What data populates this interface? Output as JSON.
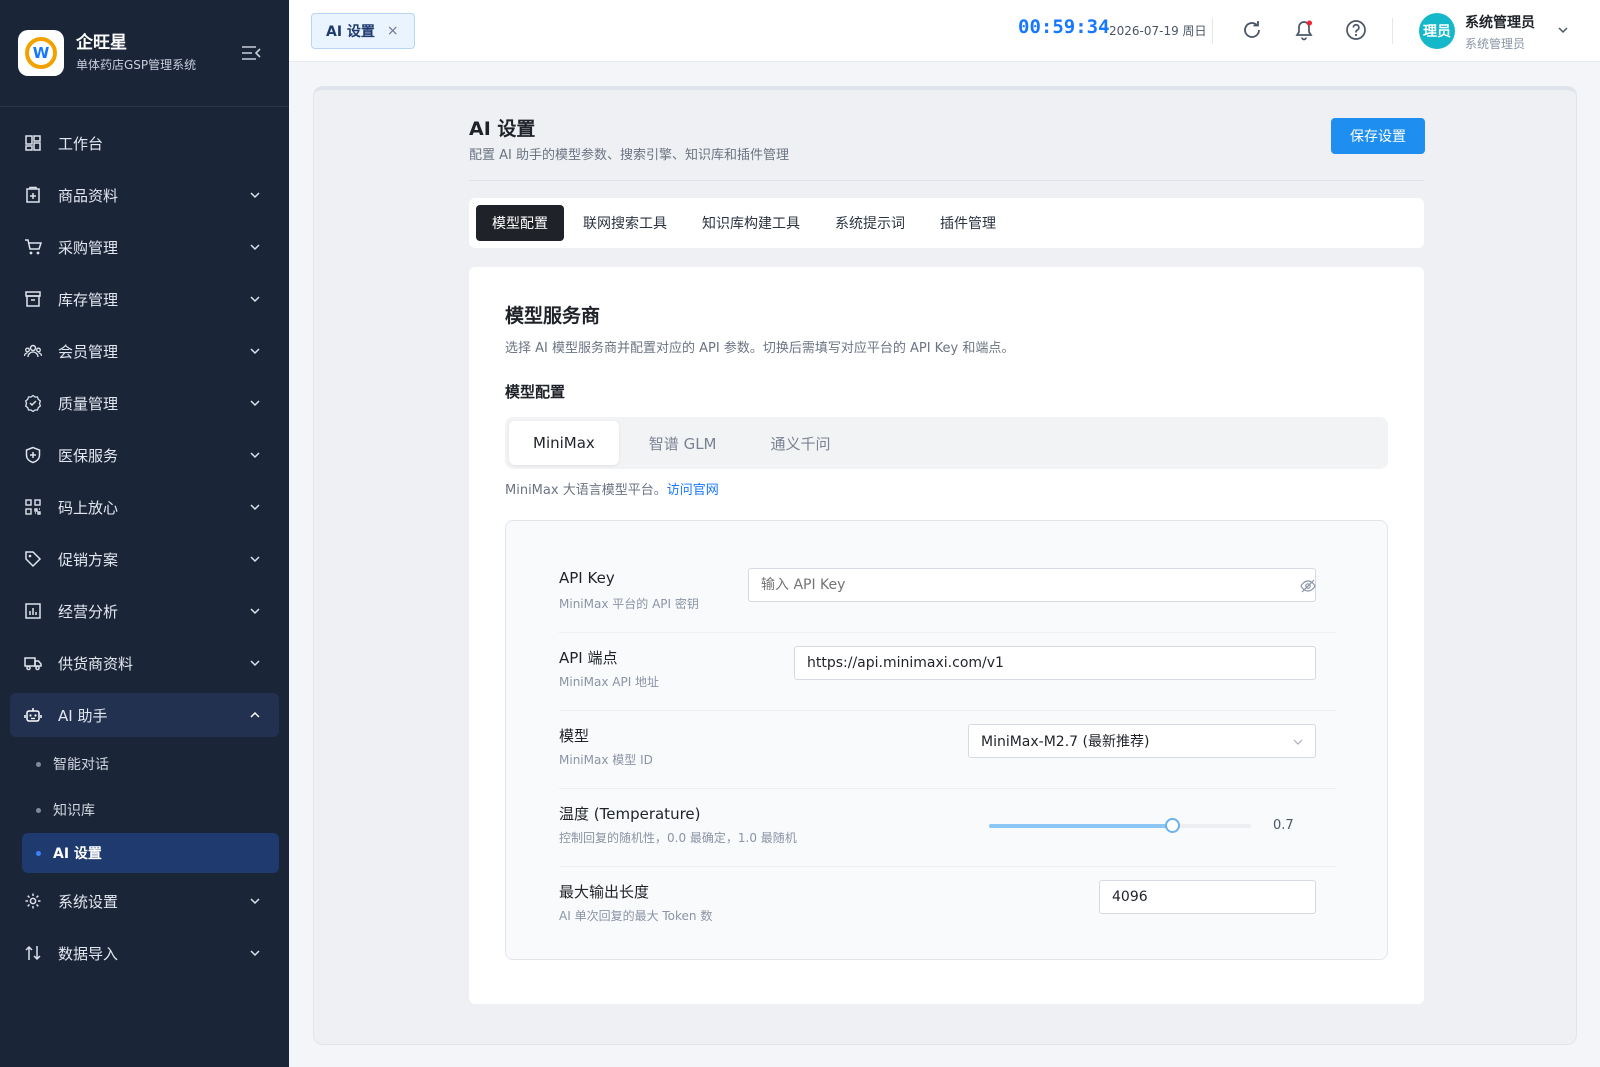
{
  "brand": {
    "title": "企旺星",
    "subtitle": "单体药店GSP管理系统",
    "logo_letter": "W"
  },
  "sidebar": {
    "items": [
      {
        "label": "工作台",
        "icon": "dashboard-icon"
      },
      {
        "label": "商品资料",
        "icon": "product-icon"
      },
      {
        "label": "采购管理",
        "icon": "cart-icon"
      },
      {
        "label": "库存管理",
        "icon": "archive-icon"
      },
      {
        "label": "会员管理",
        "icon": "members-icon"
      },
      {
        "label": "质量管理",
        "icon": "badge-check-icon"
      },
      {
        "label": "医保服务",
        "icon": "shield-plus-icon"
      },
      {
        "label": "码上放心",
        "icon": "qrcode-icon"
      },
      {
        "label": "促销方案",
        "icon": "tag-icon"
      },
      {
        "label": "经营分析",
        "icon": "bar-chart-icon"
      },
      {
        "label": "供货商资料",
        "icon": "truck-icon"
      },
      {
        "label": "AI 助手",
        "icon": "robot-icon"
      },
      {
        "label": "系统设置",
        "icon": "gear-icon"
      },
      {
        "label": "数据导入",
        "icon": "import-icon"
      }
    ],
    "ai_sub": [
      {
        "label": "智能对话"
      },
      {
        "label": "知识库"
      },
      {
        "label": "AI 设置"
      }
    ]
  },
  "header": {
    "tab_label": "AI 设置",
    "tab_close": "×",
    "clock": "00:59:34",
    "date": "2026-07-19 周日",
    "avatar_text": "理员",
    "user_name": "系统管理员",
    "user_role": "系统管理员",
    "notification_dot_color": "#f5222d"
  },
  "page": {
    "title": "AI 设置",
    "description": "配置 AI 助手的模型参数、搜索引擎、知识库和插件管理",
    "save_label": "保存设置",
    "tabs": [
      "模型配置",
      "联网搜索工具",
      "知识库构建工具",
      "系统提示词",
      "插件管理"
    ]
  },
  "card": {
    "title": "模型服务商",
    "description": "选择 AI 模型服务商并配置对应的 API 参数。切换后需填写对应平台的 API Key 和端点。",
    "section_title": "模型配置",
    "providers": [
      "MiniMax",
      "智谱 GLM",
      "通义千问"
    ],
    "provider_note": "MiniMax 大语言模型平台。",
    "provider_link": "访问官网"
  },
  "settings": {
    "api_key": {
      "label": "API Key",
      "hint": "MiniMax 平台的 API 密钥",
      "placeholder": "输入 API Key"
    },
    "endpoint": {
      "label": "API 端点",
      "hint": "MiniMax API 地址",
      "value": "https://api.minimaxi.com/v1"
    },
    "model": {
      "label": "模型",
      "hint": "MiniMax 模型 ID",
      "value": "MiniMax-M2.7 (最新推荐)"
    },
    "temperature": {
      "label": "温度 (Temperature)",
      "hint": "控制回复的随机性，0.0 最确定，1.0 最随机",
      "value": 0.7,
      "display": "0.7"
    },
    "max_tokens": {
      "label": "最大输出长度",
      "hint": "AI 单次回复的最大 Token 数",
      "value": "4096"
    }
  },
  "colors": {
    "accent": "#1677ff",
    "sidebar_bg": "#1b2538",
    "primary_button": "#1e8ef0"
  }
}
